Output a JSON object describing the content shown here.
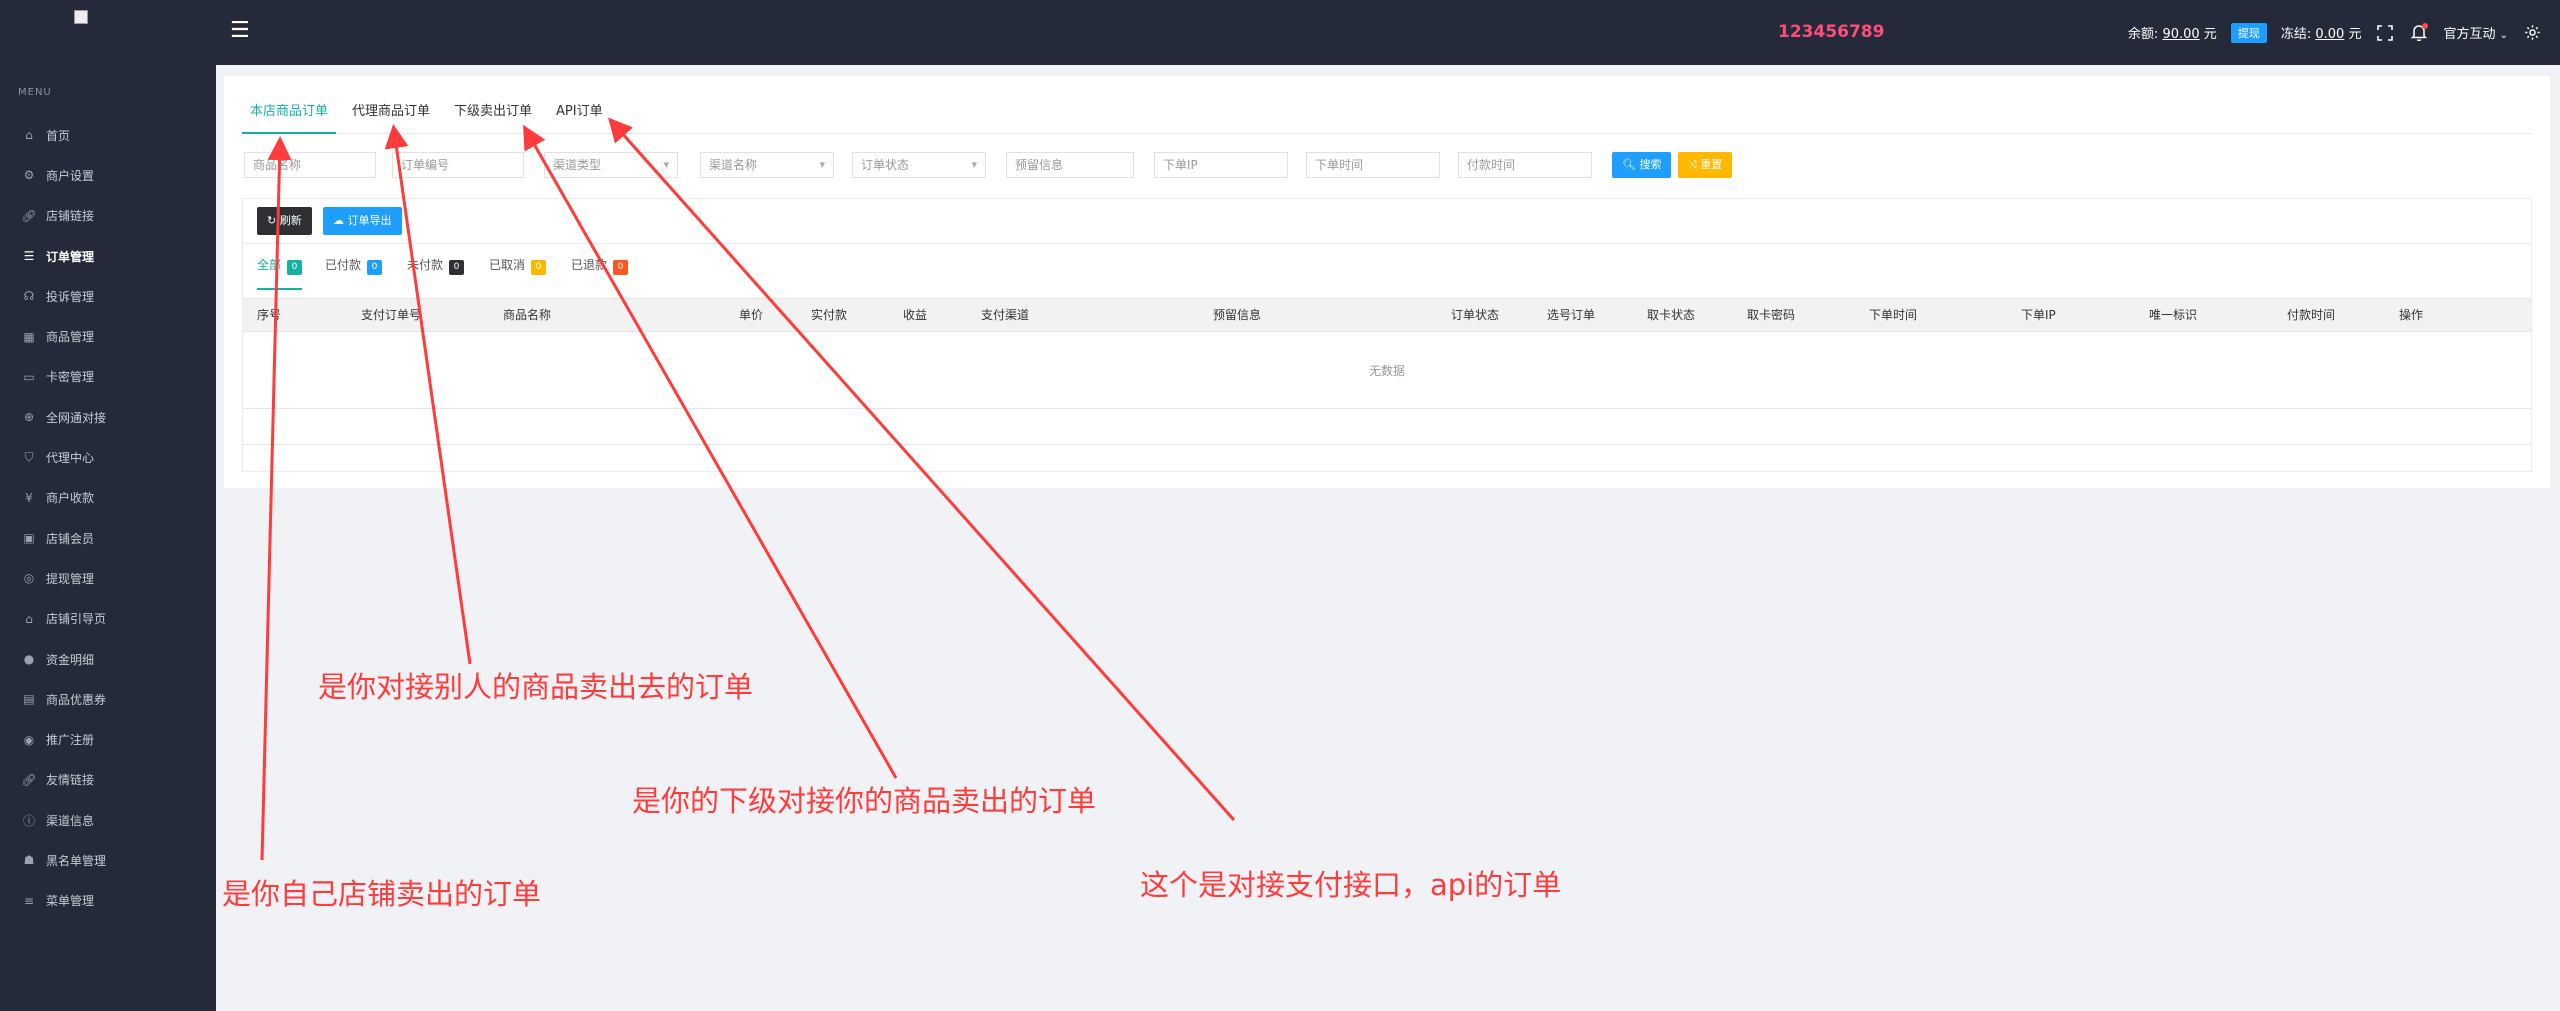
{
  "header": {
    "brand_number": "123456789",
    "balance_label": "余额:",
    "balance_value": "90.00",
    "balance_unit": "元",
    "withdraw_label": "提现",
    "frozen_label": "冻结:",
    "frozen_value": "0.00",
    "frozen_unit": "元",
    "user_name": "官方互动"
  },
  "sidebar": {
    "caption": "MENU",
    "items": [
      {
        "label": "首页",
        "icon": "home-icon"
      },
      {
        "label": "商户设置",
        "icon": "gear-icon"
      },
      {
        "label": "店铺链接",
        "icon": "link-icon"
      },
      {
        "label": "订单管理",
        "icon": "list-icon"
      },
      {
        "label": "投诉管理",
        "icon": "headset-icon"
      },
      {
        "label": "商品管理",
        "icon": "grid-icon"
      },
      {
        "label": "卡密管理",
        "icon": "card-icon"
      },
      {
        "label": "全网通对接",
        "icon": "network-icon"
      },
      {
        "label": "代理中心",
        "icon": "shield-icon"
      },
      {
        "label": "商户收款",
        "icon": "cny-icon"
      },
      {
        "label": "店铺会员",
        "icon": "vip-icon"
      },
      {
        "label": "提现管理",
        "icon": "withdraw-icon"
      },
      {
        "label": "店铺引导页",
        "icon": "store-icon"
      },
      {
        "label": "资金明细",
        "icon": "money-icon"
      },
      {
        "label": "商品优惠券",
        "icon": "coupon-icon"
      },
      {
        "label": "推广注册",
        "icon": "promote-icon"
      },
      {
        "label": "友情链接",
        "icon": "link-icon"
      },
      {
        "label": "渠道信息",
        "icon": "info-icon"
      },
      {
        "label": "黑名单管理",
        "icon": "blacklist-icon"
      },
      {
        "label": "菜单管理",
        "icon": "menu-icon"
      }
    ]
  },
  "tabs": [
    "本店商品订单",
    "代理商品订单",
    "下级卖出订单",
    "API订单"
  ],
  "filters": {
    "product_name": "商品名称",
    "order_no": "订单编号",
    "channel_type": "渠道类型",
    "channel_name": "渠道名称",
    "order_status": "订单状态",
    "reserved_info": "预留信息",
    "order_ip": "下单IP",
    "order_time": "下单时间",
    "pay_time": "付款时间",
    "search_label": "搜索",
    "reset_label": "重置"
  },
  "toolbar": {
    "refresh_label": "刷新",
    "export_label": "订单导出"
  },
  "subtabs": [
    {
      "label": "全部",
      "count": "0",
      "color": "#16b2a1"
    },
    {
      "label": "已付款",
      "count": "0",
      "color": "#1e9fff"
    },
    {
      "label": "未付款",
      "count": "0",
      "color": "#2f3033"
    },
    {
      "label": "已取消",
      "count": "0",
      "color": "#ffb800"
    },
    {
      "label": "已退款",
      "count": "0",
      "color": "#ff5722"
    }
  ],
  "table": {
    "columns": [
      "序号",
      "支付订单号",
      "商品名称",
      "单价",
      "实付款",
      "收益",
      "支付渠道",
      "预留信息",
      "订单状态",
      "选号订单",
      "取卡状态",
      "取卡密码",
      "下单时间",
      "下单IP",
      "唯一标识",
      "付款时间",
      "操作"
    ],
    "empty_text": "无数据"
  },
  "annotations": {
    "own_store": "是你自己店铺卖出的订单",
    "agent": "是你对接别人的商品卖出去的订单",
    "subordinate": "是你的下级对接你的商品卖出的订单",
    "api": "这个是对接支付接口，api的订单",
    "color": "#ff3b3b"
  }
}
